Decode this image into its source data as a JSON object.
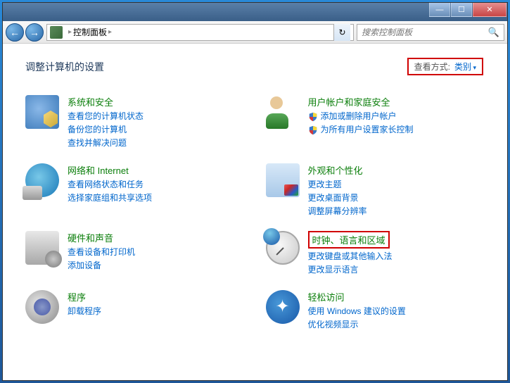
{
  "titlebar": {
    "min": "—",
    "max": "☐",
    "close": "✕"
  },
  "nav": {
    "back": "←",
    "fwd": "→",
    "breadcrumb_root": "控制面板",
    "refresh": "↻"
  },
  "search": {
    "placeholder": "搜索控制面板",
    "icon": "🔍"
  },
  "header": {
    "title": "调整计算机的设置",
    "view_label": "查看方式:",
    "view_value": "类别"
  },
  "categories": [
    {
      "id": "system-security",
      "icon": "ico-sys",
      "title": "系统和安全",
      "links": [
        "查看您的计算机状态",
        "备份您的计算机",
        "查找并解决问题"
      ],
      "shields": []
    },
    {
      "id": "user-accounts",
      "icon": "ico-user",
      "title": "用户帐户和家庭安全",
      "links": [
        "添加或删除用户帐户",
        "为所有用户设置家长控制"
      ],
      "shields": [
        0,
        1
      ]
    },
    {
      "id": "network-internet",
      "icon": "ico-net",
      "title": "网络和 Internet",
      "links": [
        "查看网络状态和任务",
        "选择家庭组和共享选项"
      ],
      "shields": []
    },
    {
      "id": "appearance",
      "icon": "ico-appear",
      "title": "外观和个性化",
      "links": [
        "更改主题",
        "更改桌面背景",
        "调整屏幕分辨率"
      ],
      "shields": []
    },
    {
      "id": "hardware-sound",
      "icon": "ico-hw",
      "title": "硬件和声音",
      "links": [
        "查看设备和打印机",
        "添加设备"
      ],
      "shields": []
    },
    {
      "id": "clock-language",
      "icon": "ico-clock",
      "title": "时钟、语言和区域",
      "highlighted": true,
      "links": [
        "更改键盘或其他输入法",
        "更改显示语言"
      ],
      "shields": []
    },
    {
      "id": "programs",
      "icon": "ico-prog",
      "title": "程序",
      "links": [
        "卸载程序"
      ],
      "shields": []
    },
    {
      "id": "ease-access",
      "icon": "ico-ease",
      "title": "轻松访问",
      "links": [
        "使用 Windows 建议的设置",
        "优化视频显示"
      ],
      "shields": []
    }
  ]
}
